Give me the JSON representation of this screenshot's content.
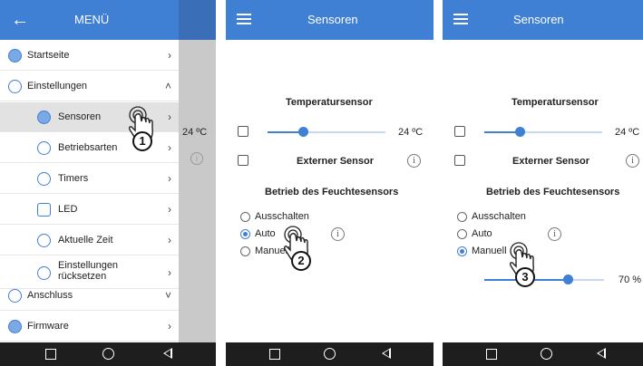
{
  "drawer": {
    "title": "MENÜ",
    "items": [
      {
        "label": "Startseite",
        "chevron": "›"
      },
      {
        "label": "Einstellungen",
        "chevron": "˄"
      },
      {
        "label": "Sensoren",
        "chevron": "›"
      },
      {
        "label": "Betriebsarten",
        "chevron": "›"
      },
      {
        "label": "Timers",
        "chevron": "›"
      },
      {
        "label": "LED",
        "chevron": "›"
      },
      {
        "label": "Aktuelle Zeit",
        "chevron": "›"
      },
      {
        "label": "Einstellungen rücksetzen",
        "chevron": "›"
      },
      {
        "label": "Anschluss",
        "chevron": "˅"
      },
      {
        "label": "Firmware",
        "chevron": "›"
      }
    ],
    "behind_temp": "24 ºC",
    "step": "1"
  },
  "screen2": {
    "title": "Sensoren",
    "temp_title": "Temperatursensor",
    "temp_value": "24 ºC",
    "temp_slider": 0.3,
    "external_label": "Externer Sensor",
    "humidity_title": "Betrieb des Feuchtesensors",
    "options": [
      "Ausschalten",
      "Auto",
      "Manuell"
    ],
    "selected": "Auto",
    "step": "2"
  },
  "screen3": {
    "title": "Sensoren",
    "temp_title": "Temperatursensor",
    "temp_value": "24 ºC",
    "temp_slider": 0.3,
    "external_label": "Externer Sensor",
    "humidity_title": "Betrieb des Feuchtesensors",
    "options": [
      "Ausschalten",
      "Auto",
      "Manuell"
    ],
    "selected": "Manuell",
    "manual_value": "70 %",
    "manual_slider": 0.7,
    "step": "3"
  },
  "info_glyph": "i",
  "back_glyph": "←",
  "colors": {
    "accent": "#3f7fd4",
    "navbar": "#1e1e1e",
    "active_row": "#e2e2e2"
  }
}
